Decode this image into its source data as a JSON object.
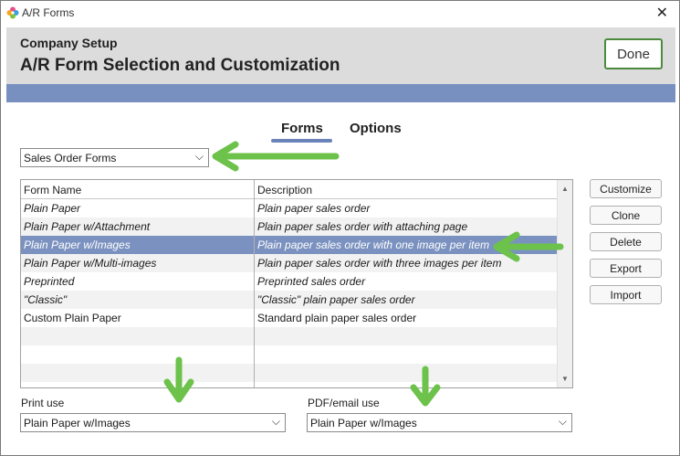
{
  "window": {
    "title": "A/R Forms",
    "app_icon": "flower-icon",
    "close_icon": "close-icon",
    "close_glyph": "✕"
  },
  "header": {
    "subtitle": "Company Setup",
    "title": "A/R Form Selection and Customization",
    "done_label": "Done",
    "accent": "#7890bf"
  },
  "tabs": [
    {
      "label": "Forms",
      "active": true
    },
    {
      "label": "Options",
      "active": false
    }
  ],
  "form_type": {
    "value": "Sales Order Forms",
    "icon": "chevron-down-icon",
    "glyph": "⌵"
  },
  "table": {
    "columns": [
      "Form Name",
      "Description"
    ],
    "rows": [
      {
        "name": "Plain Paper",
        "desc": "Plain paper sales order"
      },
      {
        "name": "Plain Paper w/Attachment",
        "desc": "Plain paper sales order with attaching page"
      },
      {
        "name": "Plain Paper w/Images",
        "desc": "Plain paper sales order with one image per item"
      },
      {
        "name": "Plain Paper w/Multi-images",
        "desc": "Plain paper sales order with three images per item"
      },
      {
        "name": "Preprinted",
        "desc": "Preprinted sales order"
      },
      {
        "name": "\"Classic\"",
        "desc": "\"Classic\" plain paper sales order"
      },
      {
        "name": "Custom Plain Paper",
        "desc": "Standard plain paper sales order"
      }
    ],
    "selected_row": "Plain Paper w/Images",
    "selection_color": "#7b92c0",
    "scroll_up_glyph": "▲",
    "scroll_down_glyph": "▼"
  },
  "actions": [
    "Customize",
    "Clone",
    "Delete",
    "Export",
    "Import"
  ],
  "print_use": {
    "label": "Print use",
    "value": "Plain Paper w/Images"
  },
  "pdf_use": {
    "label": "PDF/email use",
    "value": "Plain Paper w/Images"
  },
  "annotations": {
    "arrow_color": "#6cc24a",
    "arrows": [
      "left-arrow-icon",
      "left-arrow-icon",
      "down-arrow-icon",
      "down-arrow-icon"
    ]
  }
}
